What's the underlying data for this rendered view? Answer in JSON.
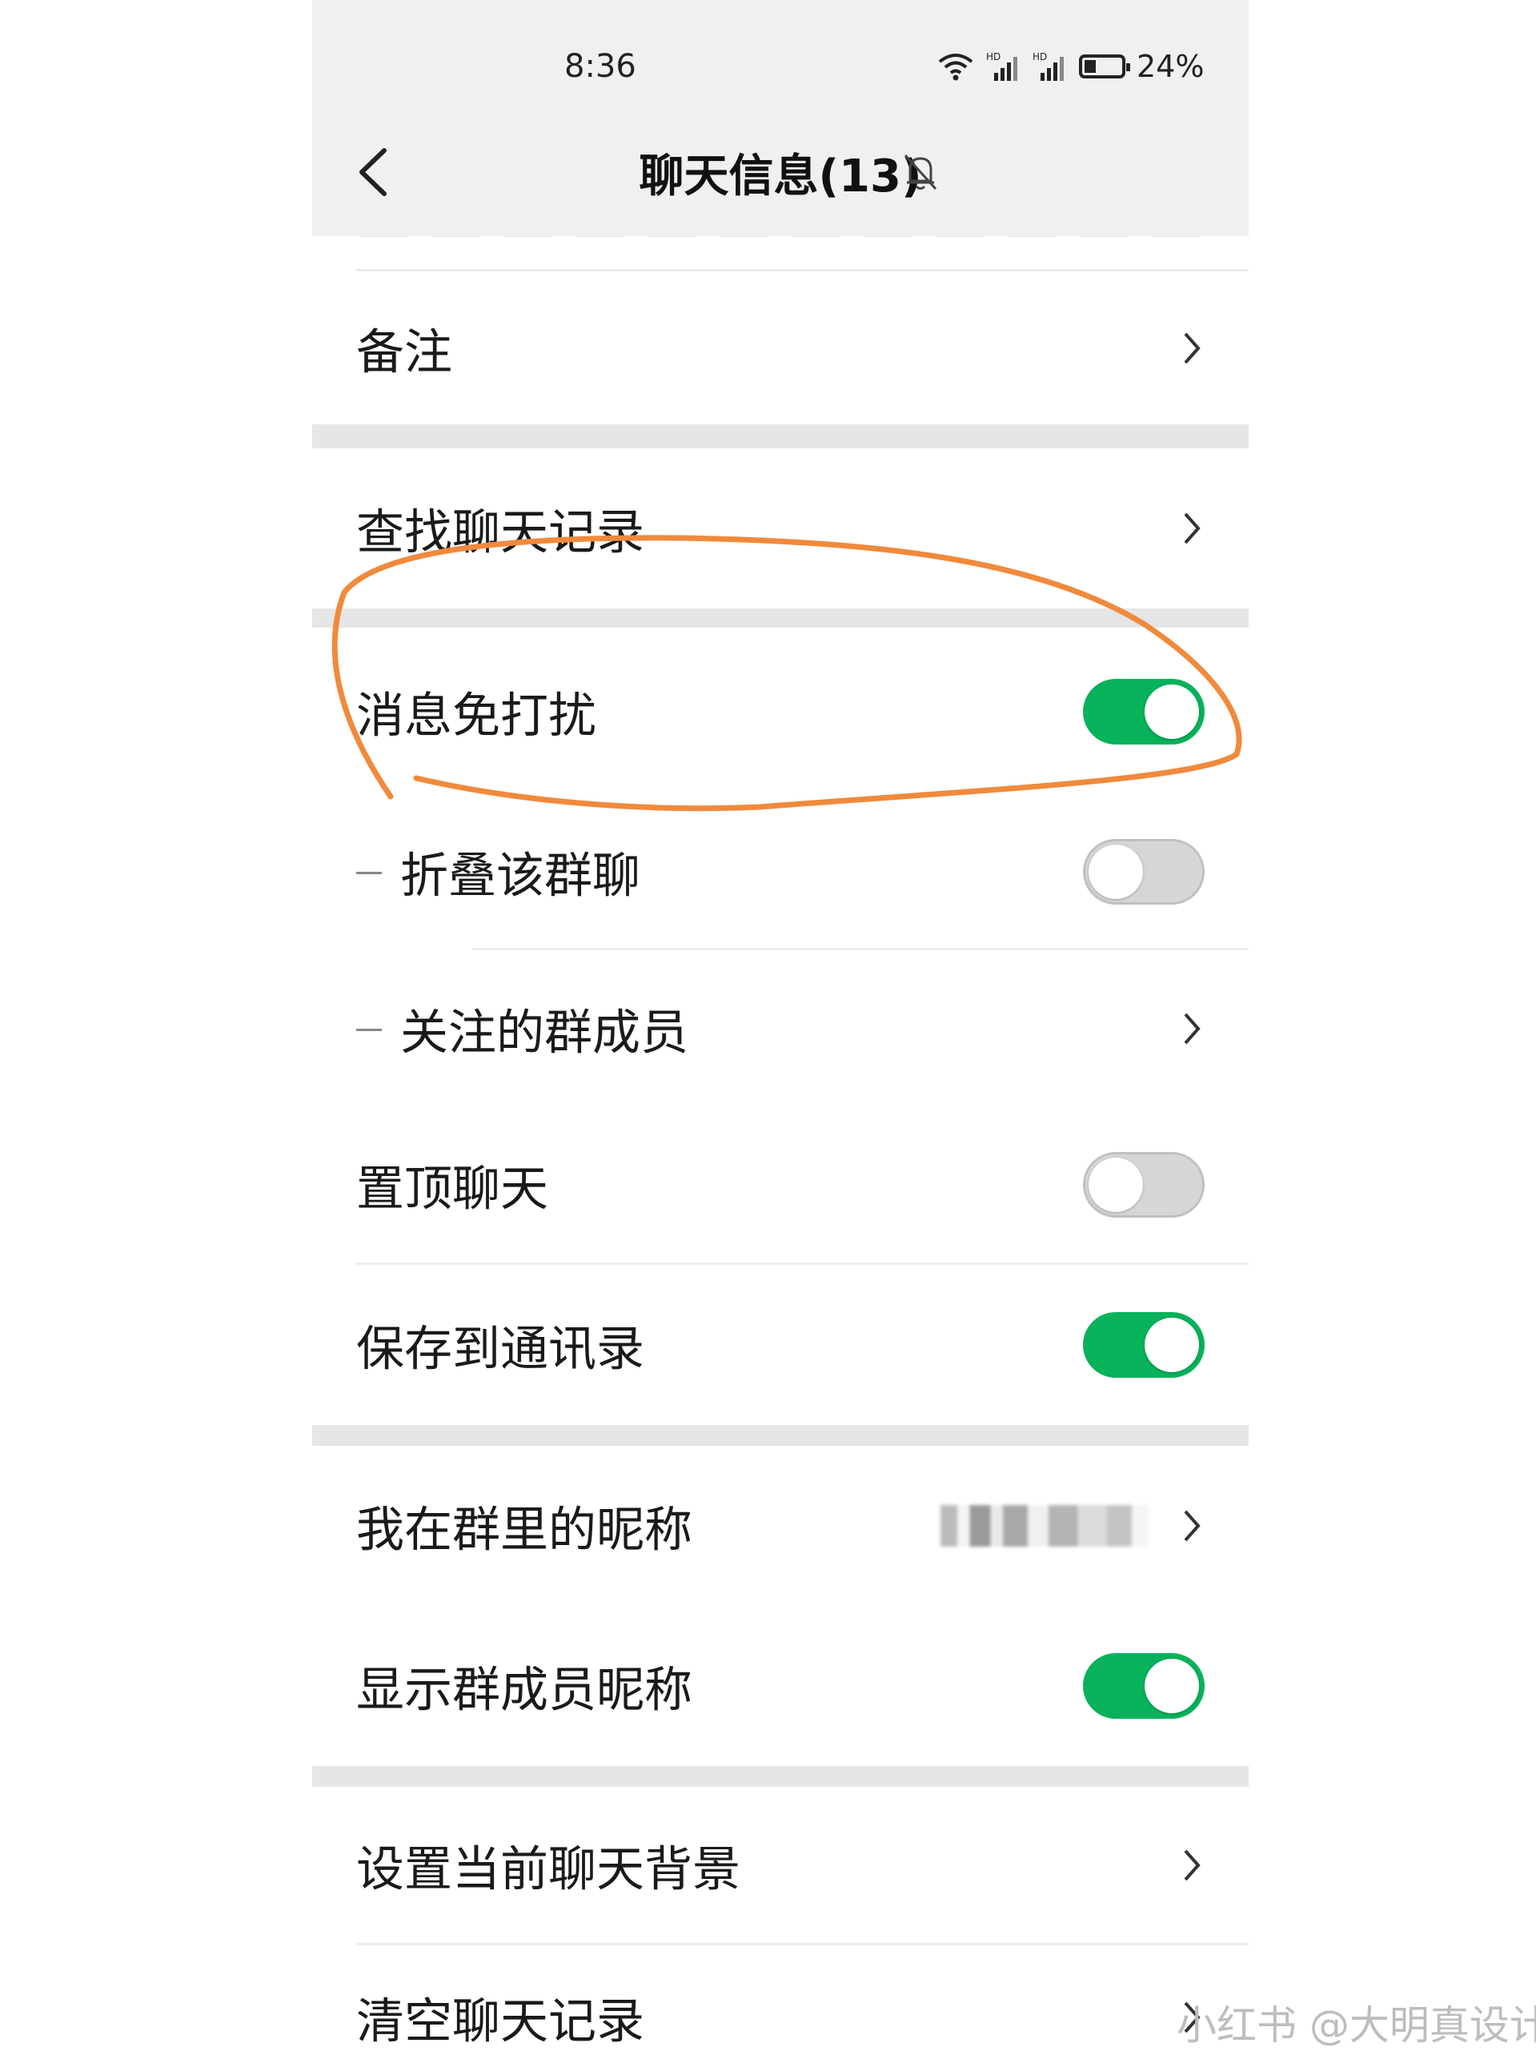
{
  "status_bar": {
    "time": "8:36",
    "battery": "24%",
    "network_badge": "HD"
  },
  "header": {
    "title": "聊天信息(13)"
  },
  "rows": [
    {
      "label": "备注"
    },
    {
      "label": "查找聊天记录"
    },
    {
      "label": "消息免打扰",
      "on": true
    },
    {
      "label": "折叠该群聊",
      "on": false
    },
    {
      "label": "关注的群成员"
    },
    {
      "label": "置顶聊天",
      "on": false
    },
    {
      "label": "保存到通讯录",
      "on": true
    },
    {
      "label": "我在群里的昵称"
    },
    {
      "label": "显示群成员昵称",
      "on": true
    },
    {
      "label": "设置当前聊天背景"
    },
    {
      "label": "清空聊天记录"
    }
  ],
  "watermark": "小红书 @大明真设计",
  "colors": {
    "toggle_on": "#07b25a",
    "toggle_off": "#d6d6d6",
    "annotation": "#f08a3c"
  },
  "icons": [
    "back-chevron-icon",
    "mute-bell-icon",
    "wifi-icon",
    "signal-icon",
    "battery-icon",
    "chevron-right-icon"
  ]
}
